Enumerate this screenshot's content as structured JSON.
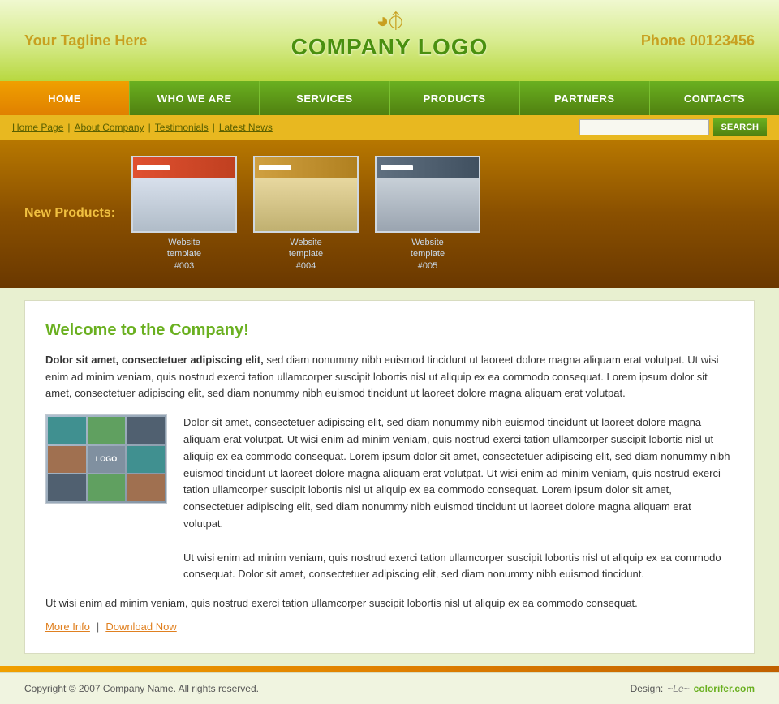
{
  "header": {
    "tagline": "Your Tagline Here",
    "logo_text": "COMPANY LOGO",
    "phone": "Phone 00123456"
  },
  "nav": {
    "items": [
      {
        "label": "HOME",
        "active": true
      },
      {
        "label": "WHO WE ARE",
        "active": false
      },
      {
        "label": "SERVICES",
        "active": false
      },
      {
        "label": "PRODUCTS",
        "active": false
      },
      {
        "label": "PARTNERS",
        "active": false
      },
      {
        "label": "CONTACTS",
        "active": false
      }
    ]
  },
  "breadcrumb": {
    "links": [
      {
        "label": "Home Page"
      },
      {
        "label": "About Company"
      },
      {
        "label": "Testimonials"
      },
      {
        "label": "Latest News"
      }
    ],
    "search_placeholder": "",
    "search_button": "SEARCH"
  },
  "products_banner": {
    "new_products_label": "New Products:",
    "items": [
      {
        "label": "Website\ntemplate\n#003"
      },
      {
        "label": "Website\ntemplate\n#004"
      },
      {
        "label": "Website\ntemplate\n#005"
      }
    ]
  },
  "main": {
    "welcome_title": "Welcome to the Company!",
    "intro_bold": "Dolor sit amet, consectetuer adipiscing elit,",
    "intro_text": " sed diam nonummy nibh euismod tincidunt ut laoreet dolore magna aliquam erat volutpat. Ut wisi enim ad minim veniam, quis nostrud exerci tation ullamcorper suscipit lobortis nisl ut aliquip ex ea commodo consequat. Lorem ipsum dolor sit amet, consectetuer adipiscing elit, sed diam nonummy nibh euismod tincidunt ut laoreet dolore magna aliquam erat volutpat.",
    "body_text": "Dolor sit amet, consectetuer adipiscing elit, sed diam nonummy nibh euismod tincidunt ut laoreet dolore magna aliquam erat volutpat. Ut wisi enim ad minim veniam, quis nostrud exerci tation ullamcorper suscipit lobortis nisl ut aliquip ex ea commodo consequat. Lorem ipsum dolor sit amet, consectetuer adipiscing elit, sed diam nonummy nibh euismod tincidunt ut laoreet dolore magna aliquam erat volutpat. Ut wisi enim ad minim veniam, quis nostrud exerci tation ullamcorper suscipit lobortis nisl ut aliquip ex ea commodo consequat. Lorem ipsum dolor sit amet, consectetuer adipiscing elit, sed diam nonummy nibh euismod tincidunt ut laoreet dolore magna aliquam erat volutpat.",
    "body_text2": "Ut wisi enim ad minim veniam, quis nostrud exerci tation ullamcorper suscipit lobortis nisl ut aliquip ex ea commodo consequat. Dolor sit amet, consectetuer adipiscing elit, sed diam nonummy nibh euismod tincidunt.",
    "bottom_text": "Ut wisi enim ad minim veniam, quis nostrud exerci tation ullamcorper suscipit lobortis nisl ut aliquip ex ea commodo consequat.",
    "link_more": "More Info",
    "link_separator": "|",
    "link_download": "Download Now"
  },
  "footer": {
    "copyright": "Copyright © 2007 Company Name. All rights reserved.",
    "design_label": "Design:",
    "design_link": "colorifer.com"
  }
}
